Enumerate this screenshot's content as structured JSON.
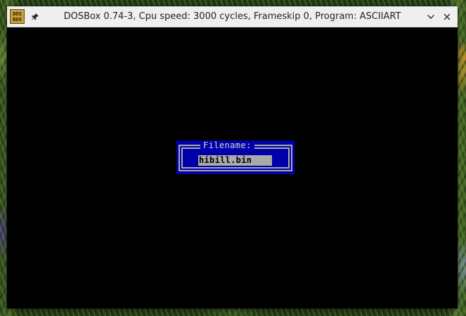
{
  "window": {
    "title": "DOSBox 0.74-3, Cpu speed: 3000 cycles, Frameskip 0, Program: ASCIIART",
    "icon_text_top": "DOS",
    "icon_text_bottom": "BOX",
    "icons": {
      "pin": "pin-icon",
      "minimize": "chevron-down-icon",
      "close": "close-icon"
    }
  },
  "dialog": {
    "title": "Filename:",
    "input_value": "hibill.bin"
  },
  "colors": {
    "dos_blue": "#0000aa",
    "dos_gray": "#aaaaaa",
    "screen_bg": "#000000",
    "titlebar_bg": "#efefef"
  }
}
